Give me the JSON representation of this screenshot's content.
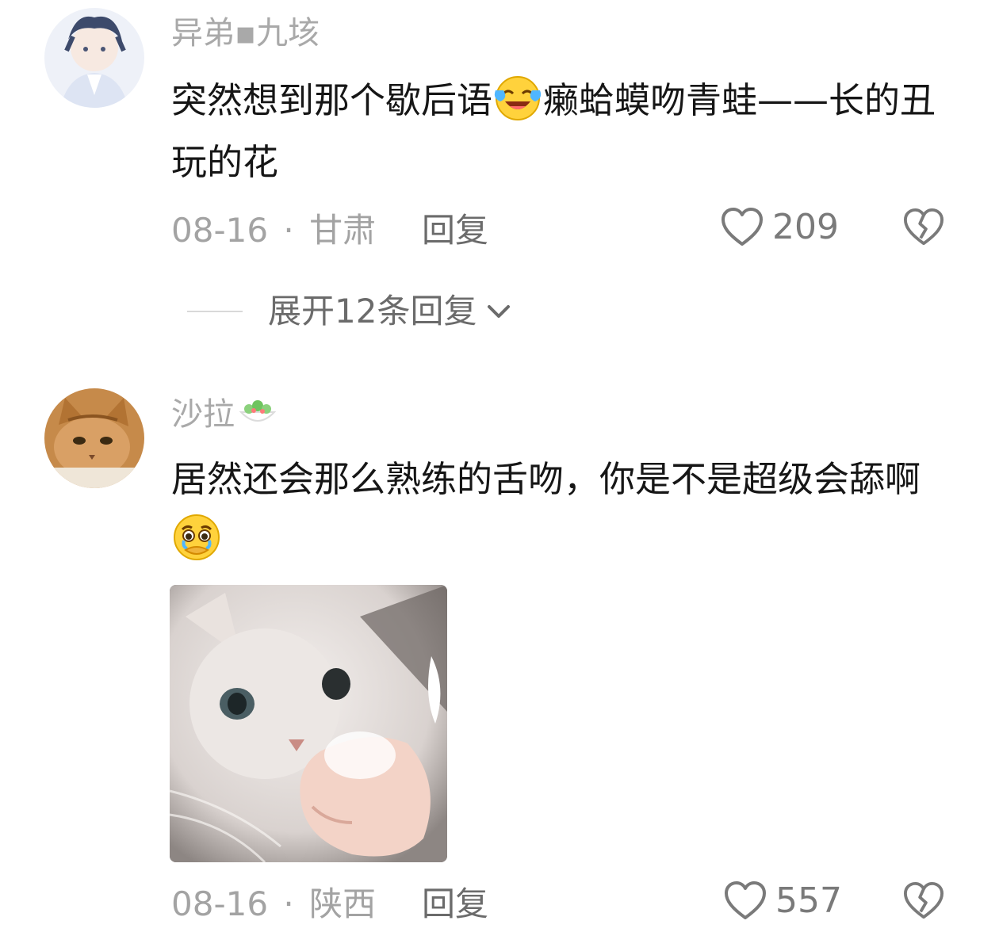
{
  "comments": [
    {
      "avatar_icon": "anime-boy-avatar-icon",
      "username": "异弟▪九垓",
      "text_part1": "突然想到那个歇后语",
      "emoji_icon": "laughing-crying-emoji-icon",
      "text_part2": "癞蛤蟆吻青蛙——长的丑玩的花",
      "date": "08-16",
      "separator": "·",
      "location": "甘肃",
      "reply_label": "回复",
      "likes": "209",
      "expand_label": "展开12条回复"
    },
    {
      "avatar_icon": "cat-avatar-icon",
      "username": "沙拉",
      "username_emoji_icon": "salad-emoji-icon",
      "text_part1": "居然还会那么熟练的舌吻，你是不是超级会舔啊",
      "emoji_icon": "holding-back-tears-emoji-icon",
      "sticker_icon": "cat-pointing-sticker-icon",
      "date": "08-16",
      "separator": "·",
      "location": "陕西",
      "reply_label": "回复",
      "likes": "557"
    }
  ],
  "colors": {
    "text": "#161616",
    "muted": "#a3a3a3",
    "reply": "#6b6b6b",
    "icon": "#7a7a7a"
  }
}
